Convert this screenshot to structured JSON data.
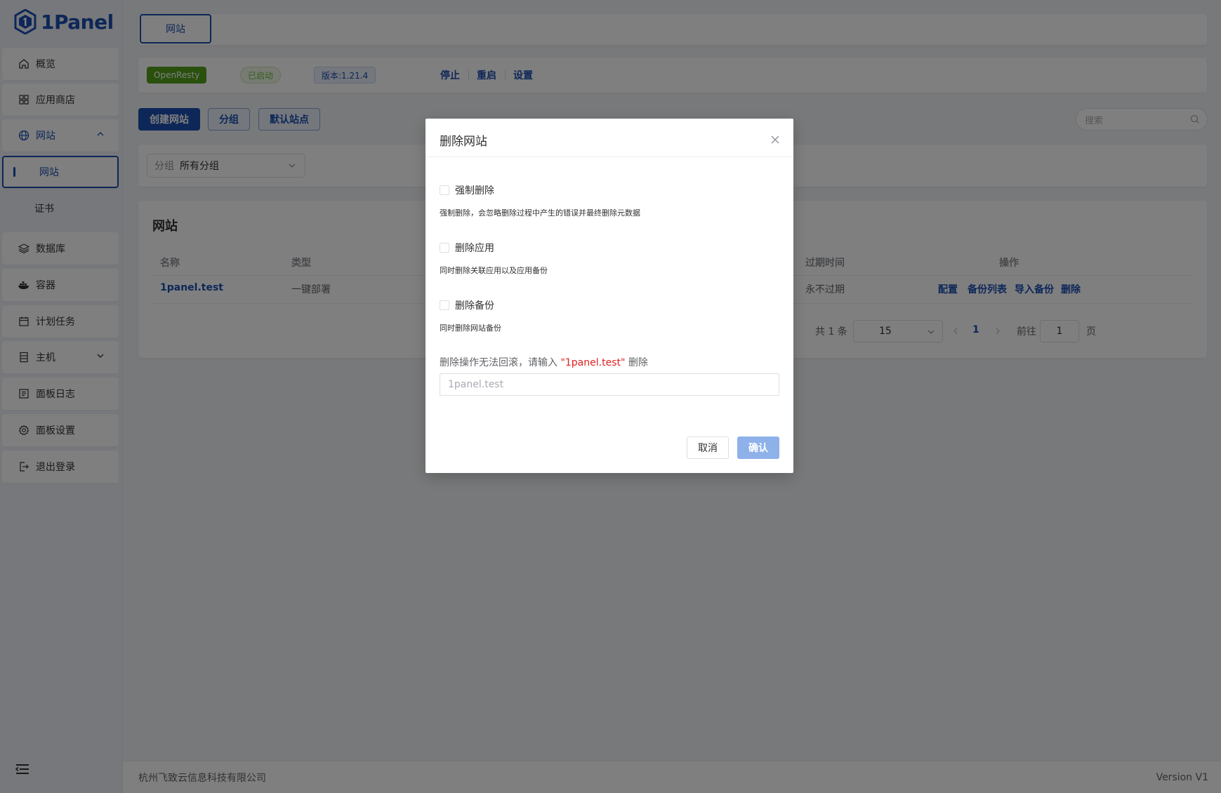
{
  "brand": {
    "name": "1Panel"
  },
  "sidebar": {
    "items": [
      {
        "label": "概览",
        "icon": "home-icon"
      },
      {
        "label": "应用商店",
        "icon": "grid-icon"
      },
      {
        "label": "网站",
        "icon": "globe-icon",
        "expanded": true
      },
      {
        "label": "网站",
        "icon": "",
        "active": true
      },
      {
        "label": "证书",
        "icon": ""
      },
      {
        "label": "数据库",
        "icon": "layers-icon"
      },
      {
        "label": "容器",
        "icon": "docker-icon"
      },
      {
        "label": "计划任务",
        "icon": "calendar-icon"
      },
      {
        "label": "主机",
        "icon": "server-icon",
        "expandable": true
      },
      {
        "label": "面板日志",
        "icon": "log-icon"
      },
      {
        "label": "面板设置",
        "icon": "gear-icon"
      },
      {
        "label": "退出登录",
        "icon": "logout-icon"
      }
    ]
  },
  "tabs": {
    "active": "网站"
  },
  "status": {
    "app_name": "OpenResty",
    "state": "已启动",
    "version": "版本:1.21.4",
    "actions": [
      "停止",
      "重启",
      "设置"
    ]
  },
  "toolbar": {
    "create": "创建网站",
    "group": "分组",
    "default_site": "默认站点",
    "search_placeholder": "搜索"
  },
  "filter": {
    "prefix": "分组",
    "value": "所有分组"
  },
  "list": {
    "title": "网站",
    "columns": [
      "名称",
      "类型",
      "过期时间",
      "操作"
    ],
    "rows": [
      {
        "name": "1panel.test",
        "type": "一键部署",
        "expiry": "永不过期",
        "ops": [
          "配置",
          "备份列表",
          "导入备份",
          "删除"
        ]
      }
    ],
    "pagination": {
      "total": "共 1 条",
      "page_size": "15",
      "current": "1",
      "goto_label": "前往",
      "goto_value": "1",
      "page_unit": "页"
    }
  },
  "footer": {
    "company": "杭州飞致云信息科技有限公司",
    "version": "Version V1"
  },
  "dialog": {
    "title": "删除网站",
    "options": [
      {
        "label": "强制删除",
        "hint": "强制删除，会忽略删除过程中产生的错误并最终删除元数据",
        "checked": false
      },
      {
        "label": "删除应用",
        "hint": "同时删除关联应用以及应用备份",
        "checked": false
      },
      {
        "label": "删除备份",
        "hint": "同时删除网站备份",
        "checked": false
      }
    ],
    "confirm_prefix": "删除操作无法回滚，请输入 ",
    "confirm_target": "\"1panel.test\"",
    "confirm_suffix": " 删除",
    "input_placeholder": "1panel.test",
    "cancel": "取消",
    "ok": "确认"
  },
  "colors": {
    "primary": "#1a4fb0",
    "success": "#52a11b",
    "danger": "#e02020",
    "ok_disabled": "#8fb1ea"
  }
}
